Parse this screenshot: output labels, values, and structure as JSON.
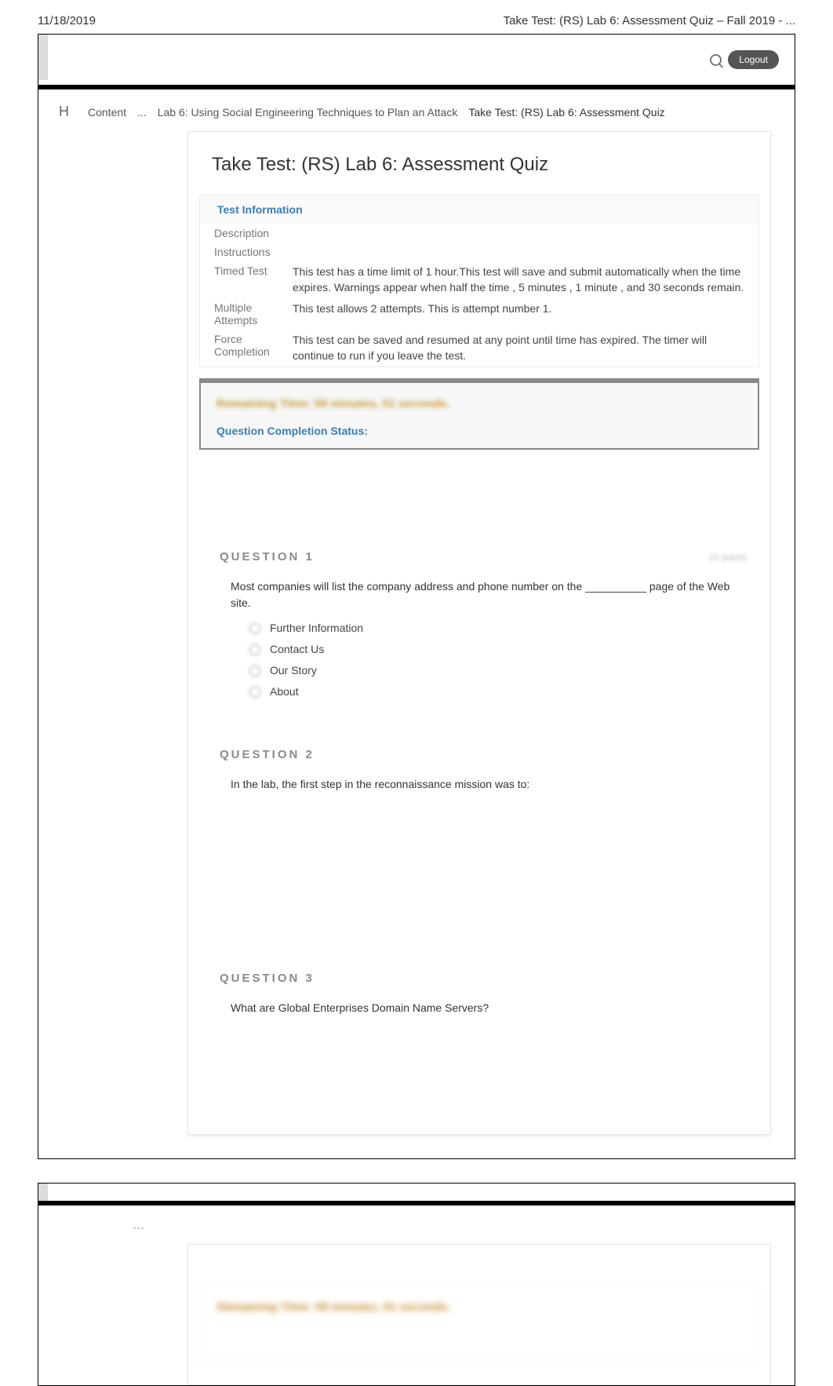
{
  "doc_date": "11/18/2019",
  "doc_title": "Take Test: (RS) Lab 6: Assessment Quiz – Fall 2019 - ...",
  "logout_label": "Logout",
  "breadcrumbs": {
    "home": "H",
    "content": "Content",
    "sep": "...",
    "lab": "Lab 6: Using Social Engineering Techniques to Plan an Attack",
    "current": "Take Test: (RS) Lab 6: Assessment Quiz"
  },
  "panel_title": "Take Test: (RS) Lab 6: Assessment Quiz",
  "info": {
    "header": "Test Information",
    "rows": [
      {
        "label": "Description",
        "value": ""
      },
      {
        "label": "Instructions",
        "value": ""
      },
      {
        "label": "Timed Test",
        "value": "This test has a time limit of 1 hour.This test will save and submit automatically when the time expires. Warnings appear when      half the time   , 5 minutes   , 1 minute   , and  30 seconds     remain."
      },
      {
        "label": "Multiple Attempts",
        "value": "This test allows 2 attempts. This is attempt number 1."
      },
      {
        "label": "Force Completion",
        "value": "This test can be saved and resumed at any point until time has expired. The timer will continue to run if you leave the test."
      }
    ]
  },
  "timer_line": "Remaining Time: 59 minutes, 51 seconds.",
  "qcs": "Question Completion Status:",
  "questions": [
    {
      "title": "QUESTION 1",
      "points": "10 points",
      "text": "Most companies will list the company address and phone number on the __________ page of the Web site.",
      "options": [
        "Further Information",
        "Contact Us",
        "Our Story",
        "About"
      ]
    },
    {
      "title": "QUESTION 2",
      "points": "",
      "text": "In the lab, the first step in the reconnaissance mission was to:",
      "options": []
    },
    {
      "title": "QUESTION 3",
      "points": "",
      "text": "What are Global Enterprises Domain Name Servers?",
      "options": []
    }
  ],
  "dots": "..."
}
